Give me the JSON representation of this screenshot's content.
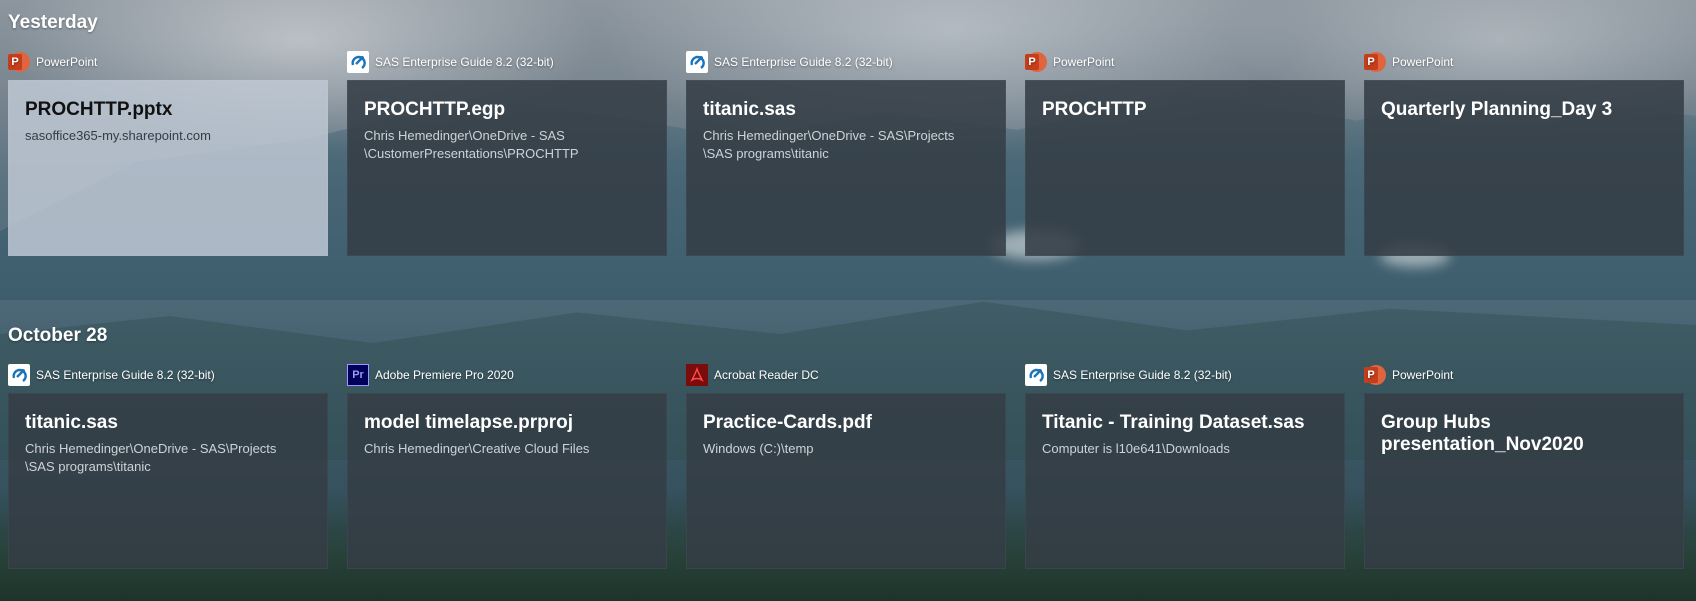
{
  "sections": [
    {
      "heading": "Yesterday",
      "cards": [
        {
          "app": "PowerPoint",
          "icon": "powerpoint-icon",
          "title": "PROCHTTP.pptx",
          "path": "sasoffice365-my.sharepoint.com",
          "selected": true
        },
        {
          "app": "SAS Enterprise Guide 8.2 (32-bit)",
          "icon": "sas-enterprise-guide-icon",
          "title": "PROCHTTP.egp",
          "path": "Chris Hemedinger\\OneDrive - SAS\n\\CustomerPresentations\\PROCHTTP",
          "selected": false
        },
        {
          "app": "SAS Enterprise Guide 8.2 (32-bit)",
          "icon": "sas-enterprise-guide-icon",
          "title": "titanic.sas",
          "path": "Chris Hemedinger\\OneDrive - SAS\\Projects\n\\SAS programs\\titanic",
          "selected": false
        },
        {
          "app": "PowerPoint",
          "icon": "powerpoint-icon",
          "title": "PROCHTTP",
          "path": "",
          "selected": false
        },
        {
          "app": "PowerPoint",
          "icon": "powerpoint-icon",
          "title": "Quarterly Planning_Day 3",
          "path": "",
          "selected": false
        }
      ]
    },
    {
      "heading": "October 28",
      "cards": [
        {
          "app": "SAS Enterprise Guide 8.2 (32-bit)",
          "icon": "sas-enterprise-guide-icon",
          "title": "titanic.sas",
          "path": "Chris Hemedinger\\OneDrive - SAS\\Projects\n\\SAS programs\\titanic",
          "selected": false
        },
        {
          "app": "Adobe Premiere Pro 2020",
          "icon": "premiere-pro-icon",
          "title": "model timelapse.prproj",
          "path": "Chris Hemedinger\\Creative Cloud Files",
          "selected": false
        },
        {
          "app": "Acrobat Reader DC",
          "icon": "acrobat-reader-icon",
          "title": "Practice-Cards.pdf",
          "path": "Windows (C:)\\temp",
          "selected": false
        },
        {
          "app": "SAS Enterprise Guide 8.2 (32-bit)",
          "icon": "sas-enterprise-guide-icon",
          "title": "Titanic - Training Dataset.sas",
          "path": "Computer is l10e641\\Downloads",
          "selected": false
        },
        {
          "app": "PowerPoint",
          "icon": "powerpoint-icon",
          "title": "Group Hubs presentation_Nov2020",
          "path": "",
          "selected": false
        }
      ]
    }
  ],
  "icon_glyphs": {
    "powerpoint": "P",
    "sas": "SAS",
    "premiere": "Pr"
  },
  "colors": {
    "card_bg": "#343e46",
    "card_selected_bg": "#bec8d4",
    "powerpoint": "#c43e1c",
    "premiere": "#00005b",
    "acrobat": "#7a0c0c"
  }
}
